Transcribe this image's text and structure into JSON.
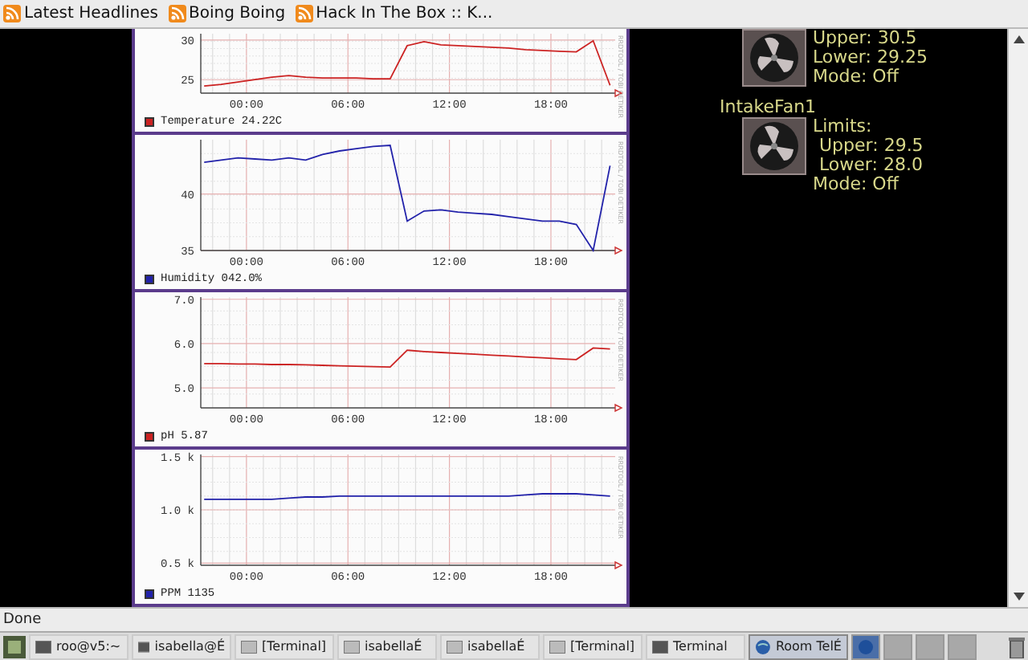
{
  "bookmarks": [
    {
      "label": "Latest Headlines"
    },
    {
      "label": "Boing Boing"
    },
    {
      "label": "Hack In The Box :: K..."
    }
  ],
  "charts": [
    {
      "reading": "24.22C",
      "side_label": "RRDTOOL / TOBI OETIKER",
      "chart_data": {
        "type": "line",
        "grid": true,
        "x": [
          -2.5,
          -1.5,
          -0.5,
          0.5,
          1.5,
          2.5,
          3.5,
          4.5,
          5.5,
          6.5,
          7.5,
          8.5,
          9.5,
          10.5,
          11.5,
          12.5,
          13.5,
          14.5,
          15.5,
          16.5,
          17.5,
          18.5,
          19.5,
          20.5,
          21.5
        ],
        "xlim": [
          -2.7,
          21.8
        ],
        "xticks": [
          {
            "value": 0,
            "label": "00:00"
          },
          {
            "value": 6,
            "label": "06:00"
          },
          {
            "value": 12,
            "label": "12:00"
          },
          {
            "value": 18,
            "label": "18:00"
          }
        ],
        "ylim": [
          23.3,
          30.8
        ],
        "yticks": [
          25,
          30
        ],
        "series": [
          {
            "name": "Temperature",
            "color": "#cc2222",
            "values": [
              24.2,
              24.4,
              24.7,
              25.0,
              25.3,
              25.5,
              25.3,
              25.2,
              25.2,
              25.2,
              25.1,
              25.1,
              29.3,
              29.8,
              29.4,
              29.3,
              29.2,
              29.1,
              29.0,
              28.8,
              28.7,
              28.6,
              28.5,
              29.9,
              24.3
            ]
          }
        ]
      }
    },
    {
      "reading": "042.0%",
      "side_label": "RRDTOOL / TOBI OETIKER",
      "chart_data": {
        "type": "line",
        "grid": true,
        "x": [
          -2.5,
          -1.5,
          -0.5,
          0.5,
          1.5,
          2.5,
          3.5,
          4.5,
          5.5,
          6.5,
          7.5,
          8.5,
          9.5,
          10.5,
          11.5,
          12.5,
          13.5,
          14.5,
          15.5,
          16.5,
          17.5,
          18.5,
          19.5,
          20.5,
          21.5
        ],
        "xlim": [
          -2.7,
          21.8
        ],
        "xticks": [
          {
            "value": 0,
            "label": "00:00"
          },
          {
            "value": 6,
            "label": "06:00"
          },
          {
            "value": 12,
            "label": "12:00"
          },
          {
            "value": 18,
            "label": "18:00"
          }
        ],
        "ylim": [
          35,
          44.8
        ],
        "yticks": [
          35,
          40
        ],
        "series": [
          {
            "name": "Humidity",
            "color": "#2222aa",
            "values": [
              42.8,
              43.0,
              43.2,
              43.1,
              43.0,
              43.2,
              43.0,
              43.5,
              43.8,
              44.0,
              44.2,
              44.3,
              37.6,
              38.5,
              38.6,
              38.4,
              38.3,
              38.2,
              38.0,
              37.8,
              37.6,
              37.6,
              37.3,
              35.0,
              42.5
            ]
          }
        ]
      }
    },
    {
      "reading": "5.87",
      "side_label": "RRDTOOL / TOBI OETIKER",
      "chart_data": {
        "type": "line",
        "grid": true,
        "x": [
          -2.5,
          -1.5,
          -0.5,
          0.5,
          1.5,
          2.5,
          3.5,
          4.5,
          5.5,
          6.5,
          7.5,
          8.5,
          9.5,
          10.5,
          11.5,
          12.5,
          13.5,
          14.5,
          15.5,
          16.5,
          17.5,
          18.5,
          19.5,
          20.5,
          21.5
        ],
        "xlim": [
          -2.7,
          21.8
        ],
        "xticks": [
          {
            "value": 0,
            "label": "00:00"
          },
          {
            "value": 6,
            "label": "06:00"
          },
          {
            "value": 12,
            "label": "12:00"
          },
          {
            "value": 18,
            "label": "18:00"
          }
        ],
        "ylim": [
          4.55,
          7.05
        ],
        "yticks": [
          {
            "value": 5,
            "label": "5.0"
          },
          {
            "value": 6,
            "label": "6.0"
          },
          {
            "value": 7,
            "label": "7.0"
          }
        ],
        "series": [
          {
            "name": "pH",
            "color": "#cc2222",
            "values": [
              5.55,
              5.55,
              5.54,
              5.54,
              5.53,
              5.53,
              5.52,
              5.51,
              5.5,
              5.49,
              5.48,
              5.47,
              5.85,
              5.82,
              5.8,
              5.78,
              5.76,
              5.74,
              5.72,
              5.7,
              5.68,
              5.66,
              5.64,
              5.9,
              5.88
            ]
          }
        ]
      }
    },
    {
      "reading": "1135",
      "side_label": "RRDTOOL / TOBI OETIKER",
      "chart_data": {
        "type": "line",
        "grid": true,
        "x": [
          -2.5,
          -1.5,
          -0.5,
          0.5,
          1.5,
          2.5,
          3.5,
          4.5,
          5.5,
          6.5,
          7.5,
          8.5,
          9.5,
          10.5,
          11.5,
          12.5,
          13.5,
          14.5,
          15.5,
          16.5,
          17.5,
          18.5,
          19.5,
          20.5,
          21.5
        ],
        "xlim": [
          -2.7,
          21.8
        ],
        "xticks": [
          {
            "value": 0,
            "label": "00:00"
          },
          {
            "value": 6,
            "label": "06:00"
          },
          {
            "value": 12,
            "label": "12:00"
          },
          {
            "value": 18,
            "label": "18:00"
          }
        ],
        "ylim": [
          480,
          1520
        ],
        "yticks": [
          {
            "value": 500,
            "label": "0.5 k"
          },
          {
            "value": 1000,
            "label": "1.0 k"
          },
          {
            "value": 1500,
            "label": "1.5 k"
          }
        ],
        "series": [
          {
            "name": "PPM",
            "color": "#2222aa",
            "values": [
              1100,
              1100,
              1100,
              1100,
              1100,
              1110,
              1120,
              1120,
              1130,
              1130,
              1130,
              1130,
              1130,
              1130,
              1130,
              1130,
              1130,
              1130,
              1130,
              1140,
              1150,
              1150,
              1150,
              1140,
              1130
            ]
          }
        ]
      }
    }
  ],
  "fans": [
    {
      "upper": "Upper: 30.5",
      "lower": "Lower: 29.25",
      "mode": "Mode: Off"
    },
    {
      "name": "IntakeFan1",
      "limits": "Limits:",
      "upper": "Upper: 29.5",
      "lower": "Lower: 28.0",
      "mode": "Mode: Off"
    }
  ],
  "status_bar": "Done",
  "tasks": [
    {
      "label": "roo@v5:~",
      "kind": "terminal",
      "selected": false
    },
    {
      "label": "isabella@É",
      "kind": "terminal",
      "selected": false
    },
    {
      "label": "[Terminal]",
      "kind": "minimized",
      "selected": false
    },
    {
      "label": "isabellaÉ",
      "kind": "minimized",
      "selected": false
    },
    {
      "label": "isabellaÉ",
      "kind": "minimized",
      "selected": false
    },
    {
      "label": "[Terminal]",
      "kind": "minimized",
      "selected": false
    },
    {
      "label": "Terminal",
      "kind": "terminal",
      "selected": false
    },
    {
      "label": "Room TelÉ",
      "kind": "browser",
      "selected": true
    }
  ],
  "pager": [
    {
      "selected": true
    },
    {
      "selected": false
    },
    {
      "selected": false
    },
    {
      "selected": false
    }
  ]
}
